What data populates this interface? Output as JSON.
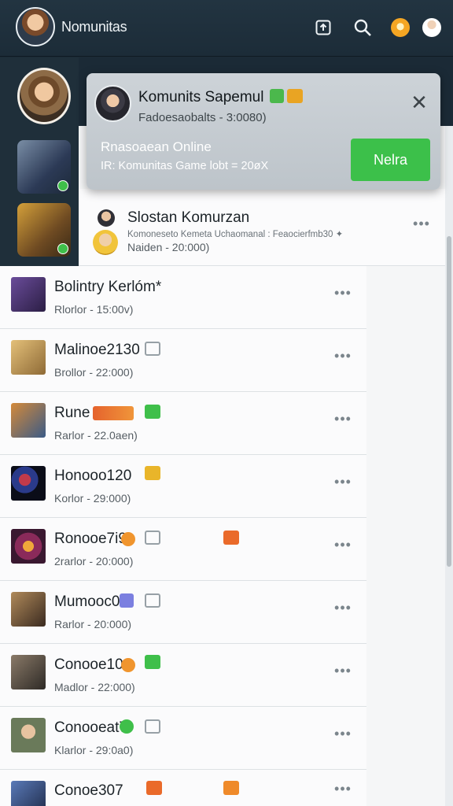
{
  "header": {
    "app_title": "Nomunitas",
    "icons": [
      "share-icon",
      "search-icon",
      "notifications-badge",
      "profile-avatar"
    ]
  },
  "popup": {
    "title": "Komunits Sapemul",
    "subtitle": "Fadoesaobalts - 3:0080)",
    "headline": "Rnasoaean Online",
    "detail": "IR: Komunitas Game lobt = 20øX",
    "button_label": "Nelra",
    "close_glyph": "✕"
  },
  "feature": {
    "name": "Slostan Komurzan",
    "sub": "Komoneseto Kemeta Uchaomanal : Feaocierfmb30 ✦",
    "meta": "Naiden - 20:000)"
  },
  "rows": [
    {
      "name": "Bolintry Kerlóm*",
      "meta": "Rlorlor - 15:00v)",
      "thumb_color": "#3d2f5a"
    },
    {
      "name": "Malinoe2130",
      "meta": "Brollor - 22:000)",
      "thumb_color": "#b68f55"
    },
    {
      "name": "Rune",
      "meta": "Rarlor - 22.0aen)",
      "thumb_color": "#6a7c90"
    },
    {
      "name": "Honooo120",
      "meta": "Korlor - 29:000)",
      "thumb_color": "#16182a"
    },
    {
      "name": "Ronooe7i9",
      "meta": "2rarlor - 20:000)",
      "thumb_color": "#5b2a38"
    },
    {
      "name": "Mumooc0V",
      "meta": "Rarlor - 20:000)",
      "thumb_color": "#4f3b2e"
    },
    {
      "name": "Conooe10",
      "meta": "Madlor - 22:000)",
      "thumb_color": "#3c3a34"
    },
    {
      "name": "Conooeat7",
      "meta": "Klarlor - 29:0a0)",
      "thumb_color": "#4e5a4a"
    },
    {
      "name": "Conoe307",
      "meta": "",
      "thumb_color": "#2f3a56"
    }
  ],
  "more_glyph": "•••",
  "colors": {
    "accent_green": "#3cc04a",
    "topbar": "#223441",
    "list_bg": "#f5f6f7"
  }
}
